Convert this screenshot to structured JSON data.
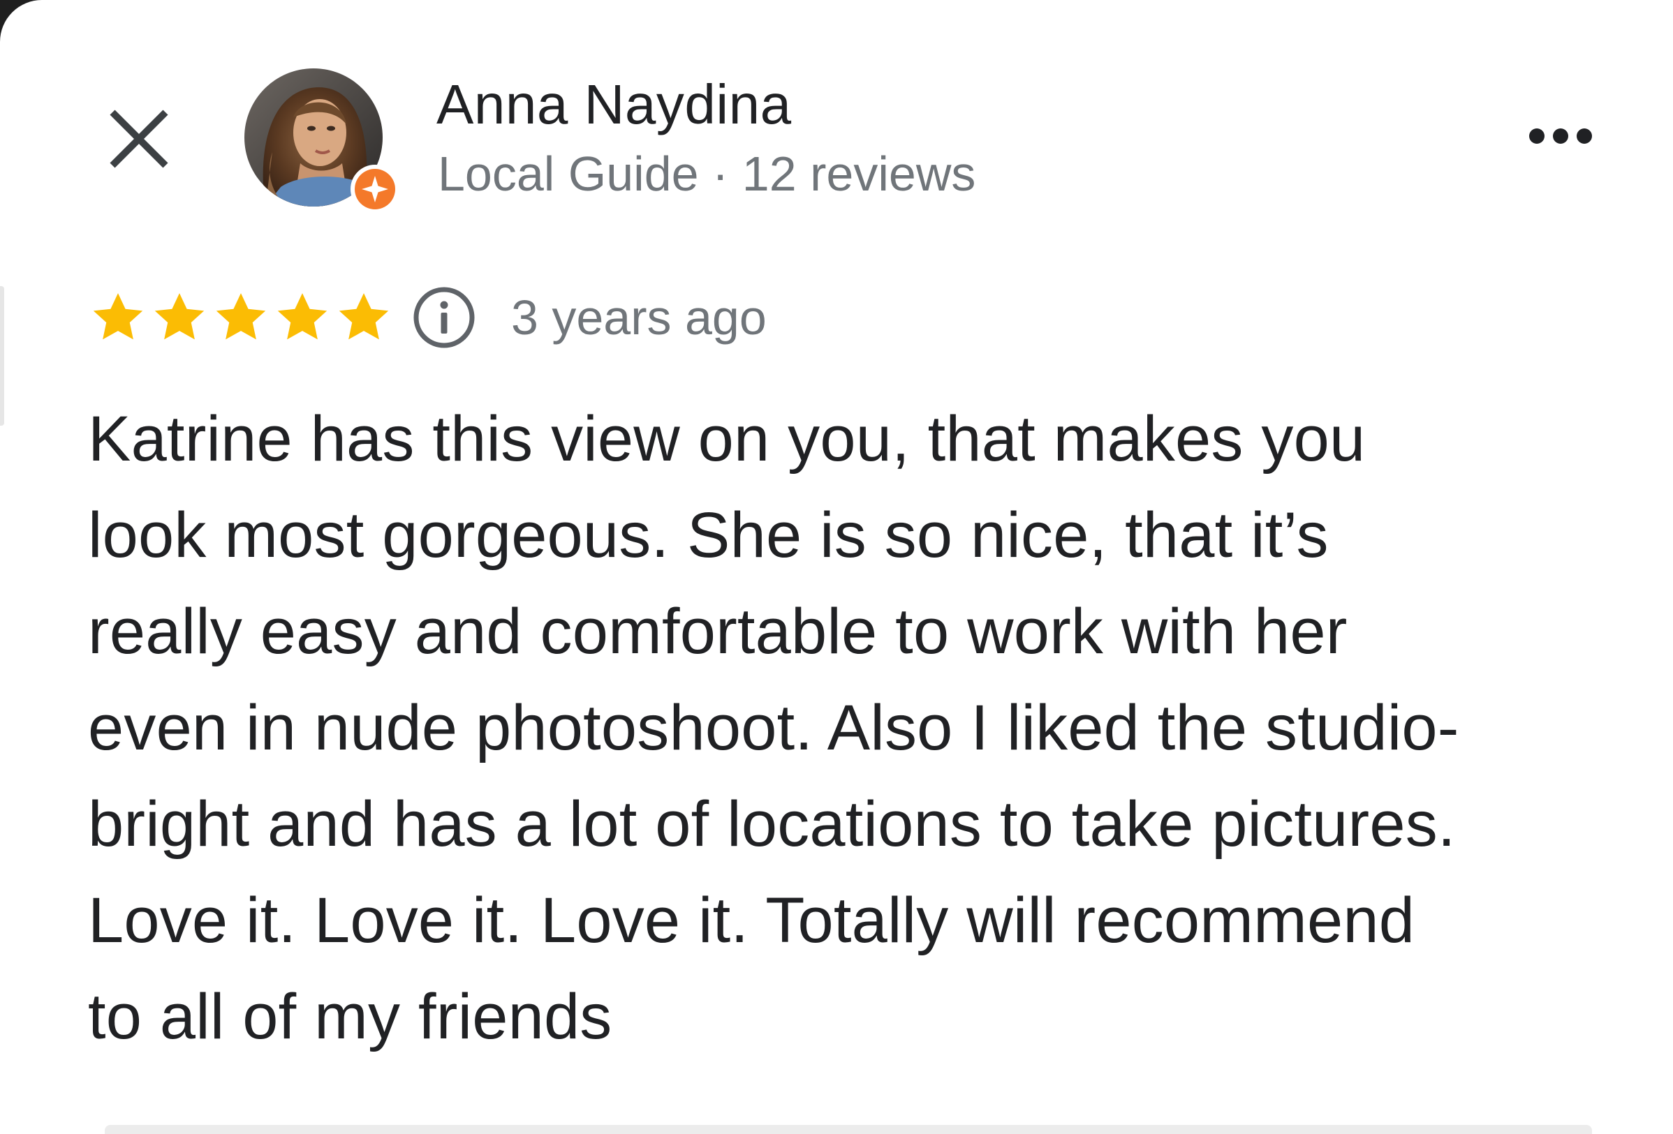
{
  "reviewer": {
    "name": "Anna Naydina",
    "meta": "Local Guide · 12 reviews",
    "avatar_icon": "profile-photo",
    "badge_icon": "local-guide-star-badge",
    "badge_color": "#f4792a"
  },
  "header": {
    "close_icon": "close-icon",
    "more_icon": "more-horizontal-icon"
  },
  "rating": {
    "stars": 5,
    "max_stars": 5,
    "star_color": "#fbbc04",
    "info_icon": "info-icon",
    "date": "3 years ago"
  },
  "review": {
    "lines": [
      "Katrine has this view on you, that makes you",
      "look most gorgeous. She is so nice, that it’s",
      "really easy and comfortable to work with her",
      "even in nude photoshoot. Also I liked the studio-",
      "bright and has a lot of locations to take pictures.",
      "Love it. Love it. Love it. Totally will recommend",
      "to all of my friends"
    ]
  }
}
